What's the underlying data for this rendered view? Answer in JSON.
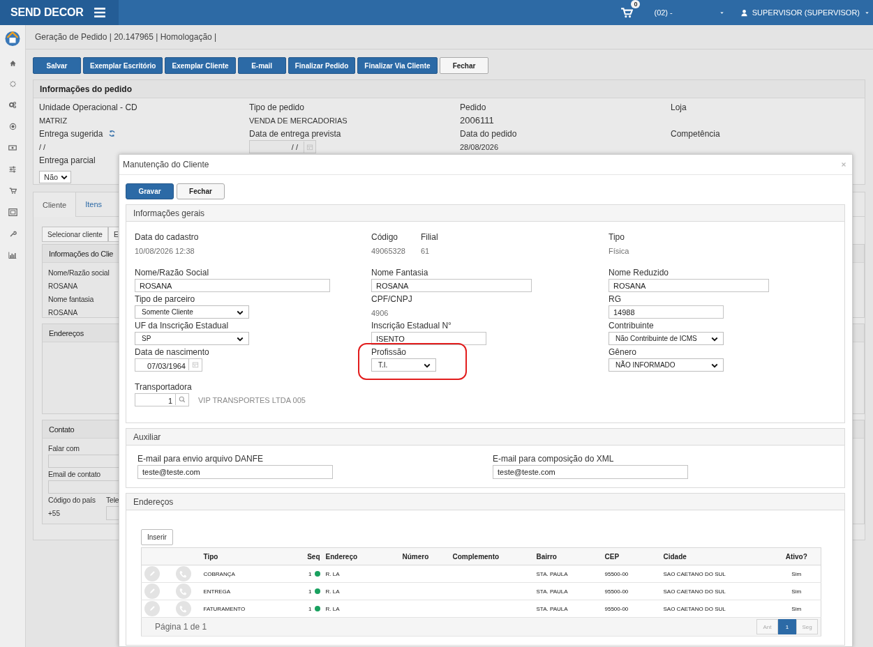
{
  "header": {
    "brand": "SEND DECOR",
    "cart_count": "0",
    "store": "(02) -",
    "user": "SUPERVISOR (SUPERVISOR)"
  },
  "breadcrumb": "Geração de Pedido | 20.147965 | Homologação |",
  "toolbar": [
    {
      "label": "Salvar",
      "kind": "primary"
    },
    {
      "label": "Exemplar Escritório",
      "kind": "primary"
    },
    {
      "label": "Exemplar Cliente",
      "kind": "primary"
    },
    {
      "label": "E-mail",
      "kind": "primary"
    },
    {
      "label": "Finalizar Pedido",
      "kind": "primary"
    },
    {
      "label": "Finalizar Via Cliente",
      "kind": "primary"
    },
    {
      "label": "Fechar",
      "kind": "default"
    }
  ],
  "order_info": {
    "title": "Informações do pedido",
    "fields": [
      {
        "label": "Unidade Operacional - CD",
        "kind": "text",
        "value": "MATRIZ"
      },
      {
        "label": "Tipo de pedido",
        "kind": "text",
        "value": "VENDA DE MERCADORIAS"
      },
      {
        "label": "Pedido",
        "kind": "big",
        "value": "2006111"
      },
      {
        "label": "Loja",
        "kind": "text"
      },
      {
        "label": "Entrega sugerida",
        "kind": "refresh-text",
        "value": "/ /"
      },
      {
        "label": "Data de entrega prevista",
        "kind": "date",
        "value": "/ /"
      },
      {
        "label": "Data do pedido",
        "kind": "text",
        "value": "28/08/2026"
      },
      {
        "label": "Competência",
        "kind": "text"
      },
      {
        "label": "Entrega parcial",
        "kind": "select",
        "value": "Não"
      }
    ]
  },
  "tabs": [
    {
      "label": "Cliente",
      "selected": true
    },
    {
      "label": "Itens",
      "selected": false
    }
  ],
  "client": {
    "buttons": [
      "Selecionar cliente",
      "E"
    ],
    "info": {
      "title": "Informações do Clie",
      "fields": [
        {
          "label": "Nome/Razão social",
          "value": "ROSANA"
        },
        {
          "label": "Nome fantasia",
          "value": "ROSANA"
        }
      ]
    },
    "addresses_title": "Endereços",
    "contact": {
      "title": "Contato",
      "fields": [
        "Falar com",
        "Email de contato"
      ],
      "country_label": "Código do país",
      "phone_label": "Tele",
      "country": "+55"
    }
  },
  "modal": {
    "title": "Manutenção do Cliente",
    "buttons": [
      {
        "label": "Gravar",
        "kind": "primary"
      },
      {
        "label": "Fechar",
        "kind": "default"
      }
    ],
    "general": {
      "title": "Informações gerais",
      "rows": [
        [
          [
            {
              "label": "Data do cadastro",
              "kind": "static",
              "value": "10/08/2026 12:38"
            }
          ],
          [
            {
              "label": "Código",
              "kind": "static",
              "value": "49065328"
            },
            {
              "label": "Filial",
              "kind": "static",
              "value": "61"
            }
          ],
          [
            {
              "label": "Tipo",
              "kind": "static",
              "value": "Física"
            }
          ]
        ],
        [
          [
            {
              "label": "Nome/Razão Social",
              "kind": "input",
              "value": "ROSANA"
            }
          ],
          [
            {
              "label": "Nome Fantasia",
              "kind": "input",
              "value": "ROSANA"
            }
          ],
          [
            {
              "label": "Nome Reduzido",
              "kind": "input",
              "value": "ROSANA"
            }
          ]
        ],
        [
          [
            {
              "label": "Tipo de parceiro",
              "kind": "select",
              "value": "Somente Cliente"
            }
          ],
          [
            {
              "label": "CPF/CNPJ",
              "kind": "static",
              "value": "4906"
            }
          ],
          [
            {
              "label": "RG",
              "kind": "input",
              "value": "14988"
            }
          ]
        ],
        [
          [
            {
              "label": "UF da Inscrição Estadual",
              "kind": "select",
              "value": "SP"
            }
          ],
          [
            {
              "label": "Inscrição Estadual N°",
              "kind": "input",
              "value": "ISENTO"
            }
          ],
          [
            {
              "label": "Contribuinte",
              "kind": "select",
              "value": "Não Contribuinte de ICMS"
            }
          ]
        ],
        [
          [
            {
              "label": "Data de nascimento",
              "kind": "date",
              "value": "07/03/1964"
            }
          ],
          [
            {
              "label": "Profissão",
              "kind": "select",
              "value": "T.I.",
              "highlighted": true
            }
          ],
          [
            {
              "label": "Gênero",
              "kind": "select",
              "value": "NÃO INFORMADO"
            }
          ]
        ],
        [
          [
            {
              "label": "Transportadora",
              "kind": "lookup",
              "value": "1",
              "description": "VIP TRANSPORTES LTDA 005"
            }
          ],
          [],
          []
        ]
      ]
    },
    "auxiliary": {
      "title": "Auxiliar",
      "fields": [
        {
          "label": "E-mail para envio arquivo DANFE",
          "value": "teste@teste.com"
        },
        {
          "label": "E-mail para composição do XML",
          "value": "teste@teste.com"
        }
      ]
    },
    "addresses": {
      "title": "Endereços",
      "insert": "Inserir",
      "columns": [
        "Tipo",
        "Seq",
        "Endereço",
        "Número",
        "Complemento",
        "Bairro",
        "CEP",
        "Cidade",
        "Ativo?"
      ],
      "rows": [
        {
          "tipo": "COBRANÇA",
          "seq": "1",
          "color": "#19a15f",
          "endereco": "R. LA",
          "bairro": "STA. PAULA",
          "cep": "95500-00",
          "cidade": "SAO CAETANO DO SUL",
          "ativo": "Sim"
        },
        {
          "tipo": "ENTREGA",
          "seq": "1",
          "color": "#19a15f",
          "endereco": "R. LA",
          "bairro": "STA. PAULA",
          "cep": "95500-00",
          "cidade": "SAO CAETANO DO SUL",
          "ativo": "Sim"
        },
        {
          "tipo": "FATURAMENTO",
          "seq": "1",
          "color": "#19a15f",
          "endereco": "R. LA",
          "bairro": "STA. PAULA",
          "cep": "95500-00",
          "cidade": "SAO CAETANO DO SUL",
          "ativo": "Sim"
        }
      ],
      "page_info": "Página 1 de 1",
      "pager": [
        {
          "label": "Ant",
          "selected": false,
          "disabled": true
        },
        {
          "label": "1",
          "selected": true,
          "disabled": false
        },
        {
          "label": "Seg",
          "selected": false,
          "disabled": true
        }
      ]
    }
  }
}
